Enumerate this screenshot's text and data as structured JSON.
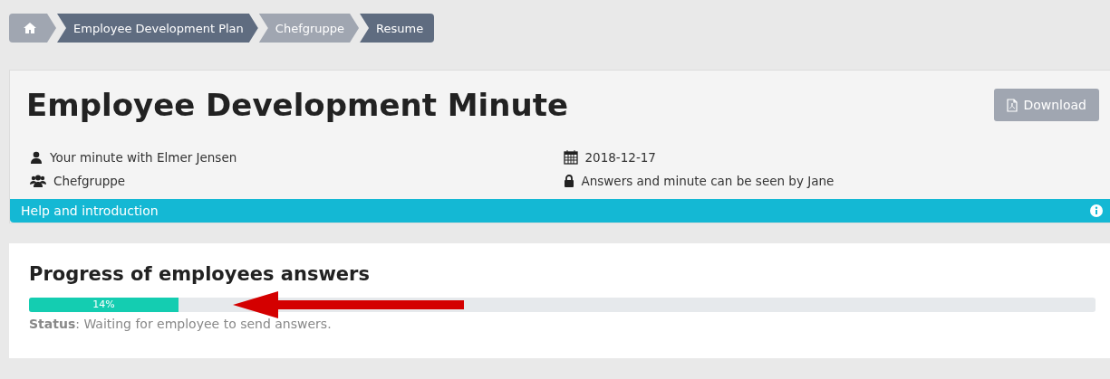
{
  "breadcrumbs": [
    {
      "kind": "home",
      "color": "#a0a6b1"
    },
    {
      "kind": "text",
      "label": "Employee Development Plan",
      "color": "#5f6c80"
    },
    {
      "kind": "text",
      "label": "Chefgruppe",
      "color": "#a0a6b1"
    },
    {
      "kind": "text",
      "label": "Resume",
      "color": "#5f6c80"
    }
  ],
  "header": {
    "title": "Employee Development Minute",
    "download_button": "Download",
    "info_left": [
      {
        "kind": "user",
        "text": "Your minute with Elmer Jensen"
      },
      {
        "kind": "group",
        "text": "Chefgruppe"
      }
    ],
    "info_right": [
      {
        "kind": "calendar",
        "text": "2018-12-17"
      },
      {
        "kind": "lock",
        "text": "Answers and minute can be seen by Jane"
      }
    ],
    "help_bar": "Help and introduction"
  },
  "progress": {
    "title": "Progress of employees answers",
    "level": 0.14,
    "reading": "14%",
    "status": "**Status**: Waiting for employee to send answers."
  }
}
